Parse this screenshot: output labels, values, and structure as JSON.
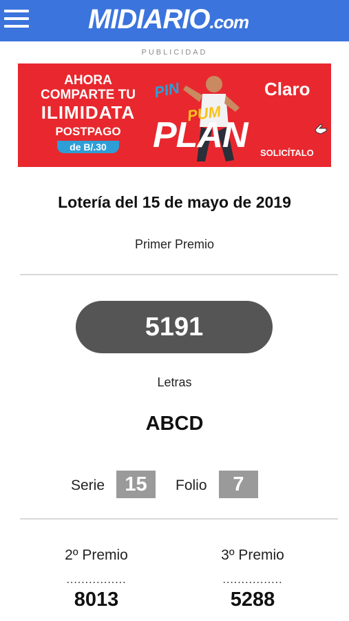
{
  "header": {
    "menu_icon": "hamburger-menu-icon",
    "logo_text": "MIDIARIO",
    "logo_suffix": ".com",
    "color": "#3b74dc"
  },
  "ad": {
    "label": "PUBLICIDAD",
    "line1": "AHORA",
    "line2": "COMPARTE TU",
    "line3": "ILIMIDATA",
    "line4": "POSTPAGO",
    "price": "de B/.30",
    "pin": "PIN",
    "pum": "PUM",
    "plan": "PLAN",
    "brand": "Claro",
    "cta": "SOLICÍTALO",
    "color": "#e8282e"
  },
  "lottery": {
    "title": "Lotería del 15 de mayo de 2019",
    "first_prize_label": "Primer Premio",
    "first_prize_number": "5191",
    "letters_label": "Letras",
    "letters_value": "ABCD",
    "serie_label": "Serie",
    "serie_value": "15",
    "folio_label": "Folio",
    "folio_value": "7",
    "second_prize_label": "2º Premio",
    "second_prize_dots": "................",
    "second_prize_number": "8013",
    "third_prize_label": "3º Premio",
    "third_prize_dots": "................",
    "third_prize_number": "5288"
  }
}
